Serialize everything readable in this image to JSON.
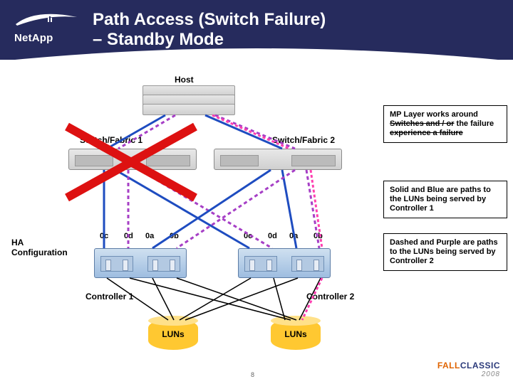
{
  "header": {
    "title_line1": "Path Access (Switch Failure)",
    "title_line2": "– Standby Mode",
    "logo_text": "NetApp"
  },
  "labels": {
    "host": "Host",
    "switch_fabric_1": "Switch/Fabric 1",
    "switch_fabric_2": "Switch/Fabric 2",
    "ha_config_l1": "HA",
    "ha_config_l2": "Configuration",
    "controller_1": "Controller 1",
    "controller_2": "Controller 2",
    "luns": "LUNs"
  },
  "ports": [
    "0c",
    "0d",
    "0a",
    "0b",
    "0c",
    "0d",
    "0a",
    "0b"
  ],
  "callouts": {
    "top_l1": "MP Layer works around",
    "top_l2": "the failure",
    "top_sub_l1": "Switches and / or",
    "top_sub_l2": "experience a failure",
    "mid": "Solid and Blue are paths to the LUNs being served by Controller 1",
    "bot": "Dashed  and Purple are paths to the LUNs being served by Controller 2"
  },
  "footer": {
    "page": "8",
    "brand_a": "FALL",
    "brand_b": "CLASSIC",
    "year": "2008"
  }
}
